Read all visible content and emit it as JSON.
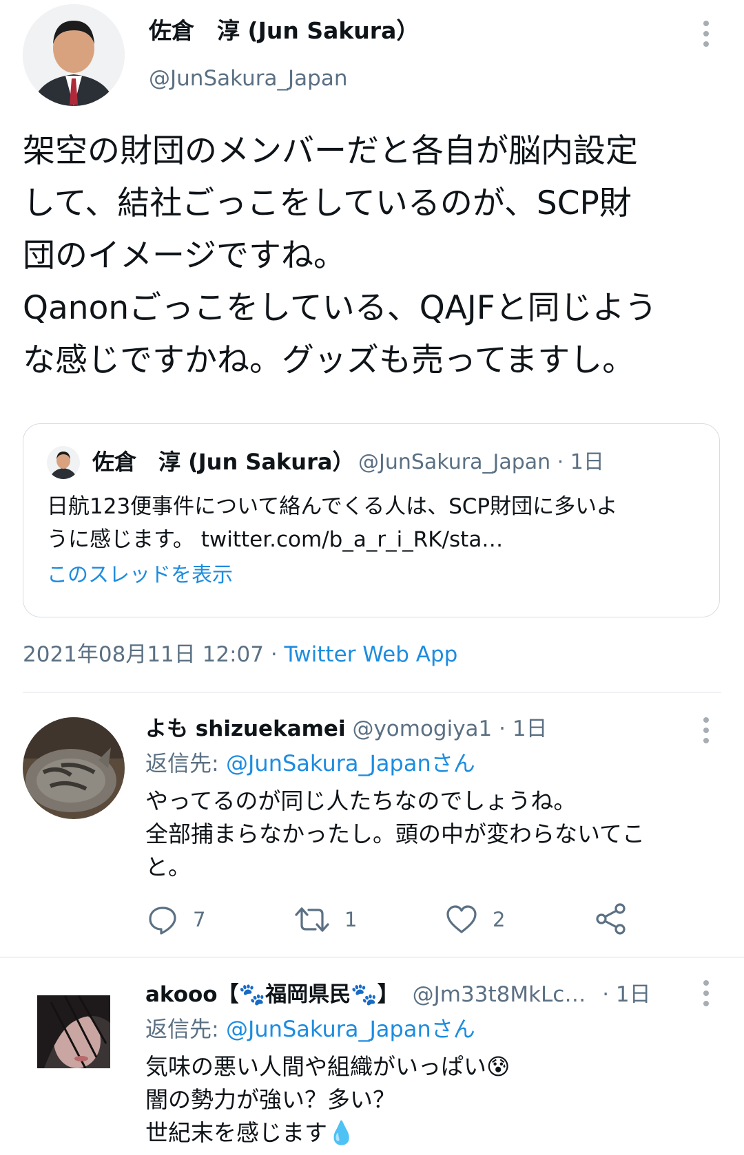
{
  "main_tweet": {
    "author_name": "佐倉　淳 (Jun Sakura）",
    "handle": "@JunSakura_Japan",
    "text_lines": [
      "架空の財団のメンバーだと各自が脳内設定",
      "して、結社ごっこをしているのが、SCP財",
      "団のイメージですね。",
      "Qanonごっこをしている、QAJFと同じよう",
      "な感じですかね。グッズも売ってますし。"
    ],
    "timestamp": "2021年08月11日 12:07 ·",
    "client": "Twitter Web App"
  },
  "quoted_tweet": {
    "author_name": "佐倉　淳 (Jun Sakura）",
    "meta": "@JunSakura_Japan · 1日",
    "text_lines": [
      "日航123便事件について絡んでくる人は、SCP財団に多いよ",
      "うに感じます。 twitter.com/b_a_r_i_RK/sta…"
    ],
    "show_thread": "このスレッドを表示"
  },
  "replies": [
    {
      "author_name": "よも shizuekamei",
      "handle_time": "@yomogiya1 · 1日",
      "reply_to_prefix": "返信先:",
      "reply_to": "@JunSakura_Japanさん",
      "text_lines": [
        "やってるのが同じ人たちなのでしょうね。",
        "全部捕まらなかったし。頭の中が変わらないてこ",
        "と。"
      ],
      "actions": {
        "reply_count": "7",
        "retweet_count": "1",
        "like_count": "2"
      }
    },
    {
      "author_name": "akooo【🐾福岡県民🐾】",
      "handle": "@Jm33t8MkLc…",
      "time": "· 1日",
      "reply_to_prefix": "返信先:",
      "reply_to": "@JunSakura_Japanさん",
      "text_lines": [
        "気味の悪い人間や組織がいっぱい😰",
        "闇の勢力が強い？多い？",
        "世紀末を感じます💧"
      ]
    }
  ],
  "colors": {
    "link_blue": "#1d8ce0",
    "secondary_gray": "#5b7083",
    "divider": "#d9dfe4"
  },
  "icons": [
    "more-icon",
    "reply-icon",
    "retweet-icon",
    "like-icon",
    "share-icon"
  ]
}
